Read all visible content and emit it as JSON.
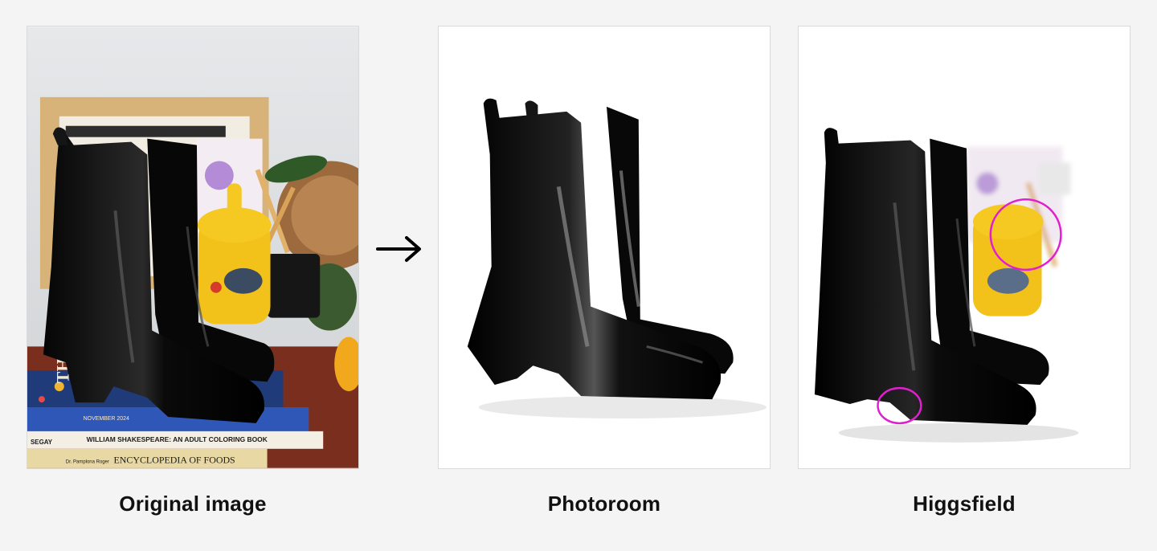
{
  "captions": {
    "original": "Original image",
    "photoroom": "Photoroom",
    "higgsfield": "Higgsfield"
  },
  "book_spines": {
    "book1": "WILLIAM SHAKESPEARE: AN ADULT COLORING BOOK",
    "book2": "ENCYCLOPEDIA OF FOODS",
    "book3": "SEGAY",
    "book4": "Dr. Pamplona Roger",
    "book5": "NOVEMBER 2024",
    "book6": "THE"
  },
  "colors": {
    "background": "#f4f4f4",
    "panel_border": "#d9d9d9",
    "highlight_circle": "#e020d0",
    "boot": "#0c0c0c",
    "jar_yellow": "#f2c21a"
  }
}
